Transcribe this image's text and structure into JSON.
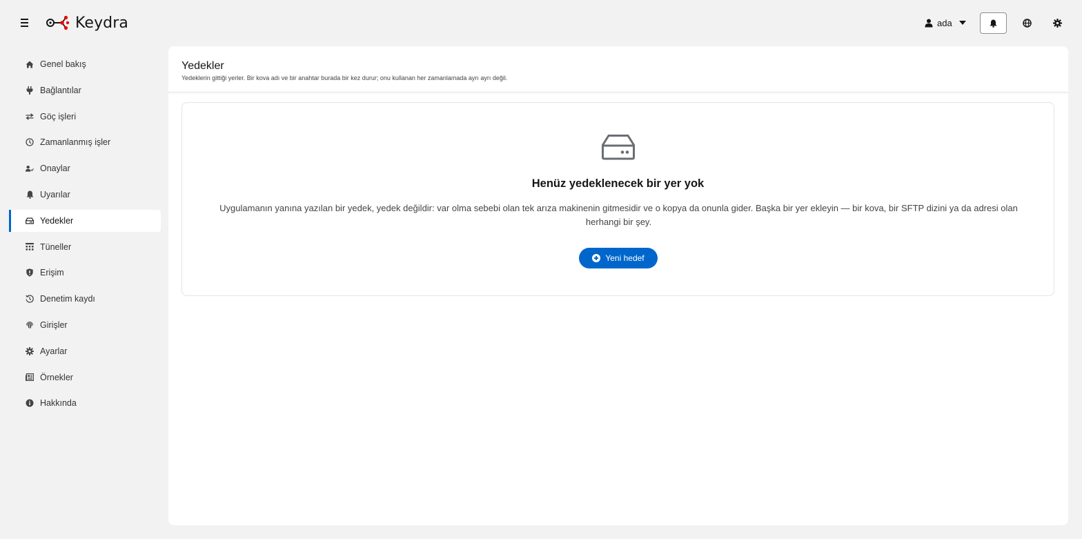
{
  "app": {
    "name": "Keydra"
  },
  "header": {
    "user": "ada"
  },
  "sidebar": {
    "items": [
      {
        "label": "Genel bakış",
        "icon": "home-icon"
      },
      {
        "label": "Bağlantılar",
        "icon": "plug-icon"
      },
      {
        "label": "Göç işleri",
        "icon": "exchange-icon"
      },
      {
        "label": "Zamanlanmış işler",
        "icon": "clock-icon"
      },
      {
        "label": "Onaylar",
        "icon": "user-check-icon"
      },
      {
        "label": "Uyarılar",
        "icon": "bell-icon"
      },
      {
        "label": "Yedekler",
        "icon": "hard-drive-icon",
        "active": true
      },
      {
        "label": "Tüneller",
        "icon": "network-icon"
      },
      {
        "label": "Erişim",
        "icon": "shield-icon"
      },
      {
        "label": "Denetim kaydı",
        "icon": "history-icon"
      },
      {
        "label": "Girişler",
        "icon": "fingerprint-icon"
      },
      {
        "label": "Ayarlar",
        "icon": "gear-icon"
      },
      {
        "label": "Örnekler",
        "icon": "newspaper-icon"
      },
      {
        "label": "Hakkında",
        "icon": "info-icon"
      }
    ]
  },
  "page": {
    "title": "Yedekler",
    "subtitle": "Yedeklerin gittiği yerler. Bir kova adı ve bir anahtar burada bir kez durur; onu kullanan her zamanlamada ayrı ayrı değil."
  },
  "empty_state": {
    "icon": "hard-drive-icon",
    "title": "Henüz yedeklenecek bir yer yok",
    "body": "Uygulamanın yanına yazılan bir yedek, yedek değildir: var olma sebebi olan tek arıza makinenin gitmesidir ve o kopya da onunla gider. Başka bir yer ekleyin — bir kova, bir SFTP dizini ya da adresi olan herhangi bir şey.",
    "button_label": "Yeni hedef"
  },
  "colors": {
    "accent": "#0066cc",
    "brand_red": "#ee0000"
  }
}
